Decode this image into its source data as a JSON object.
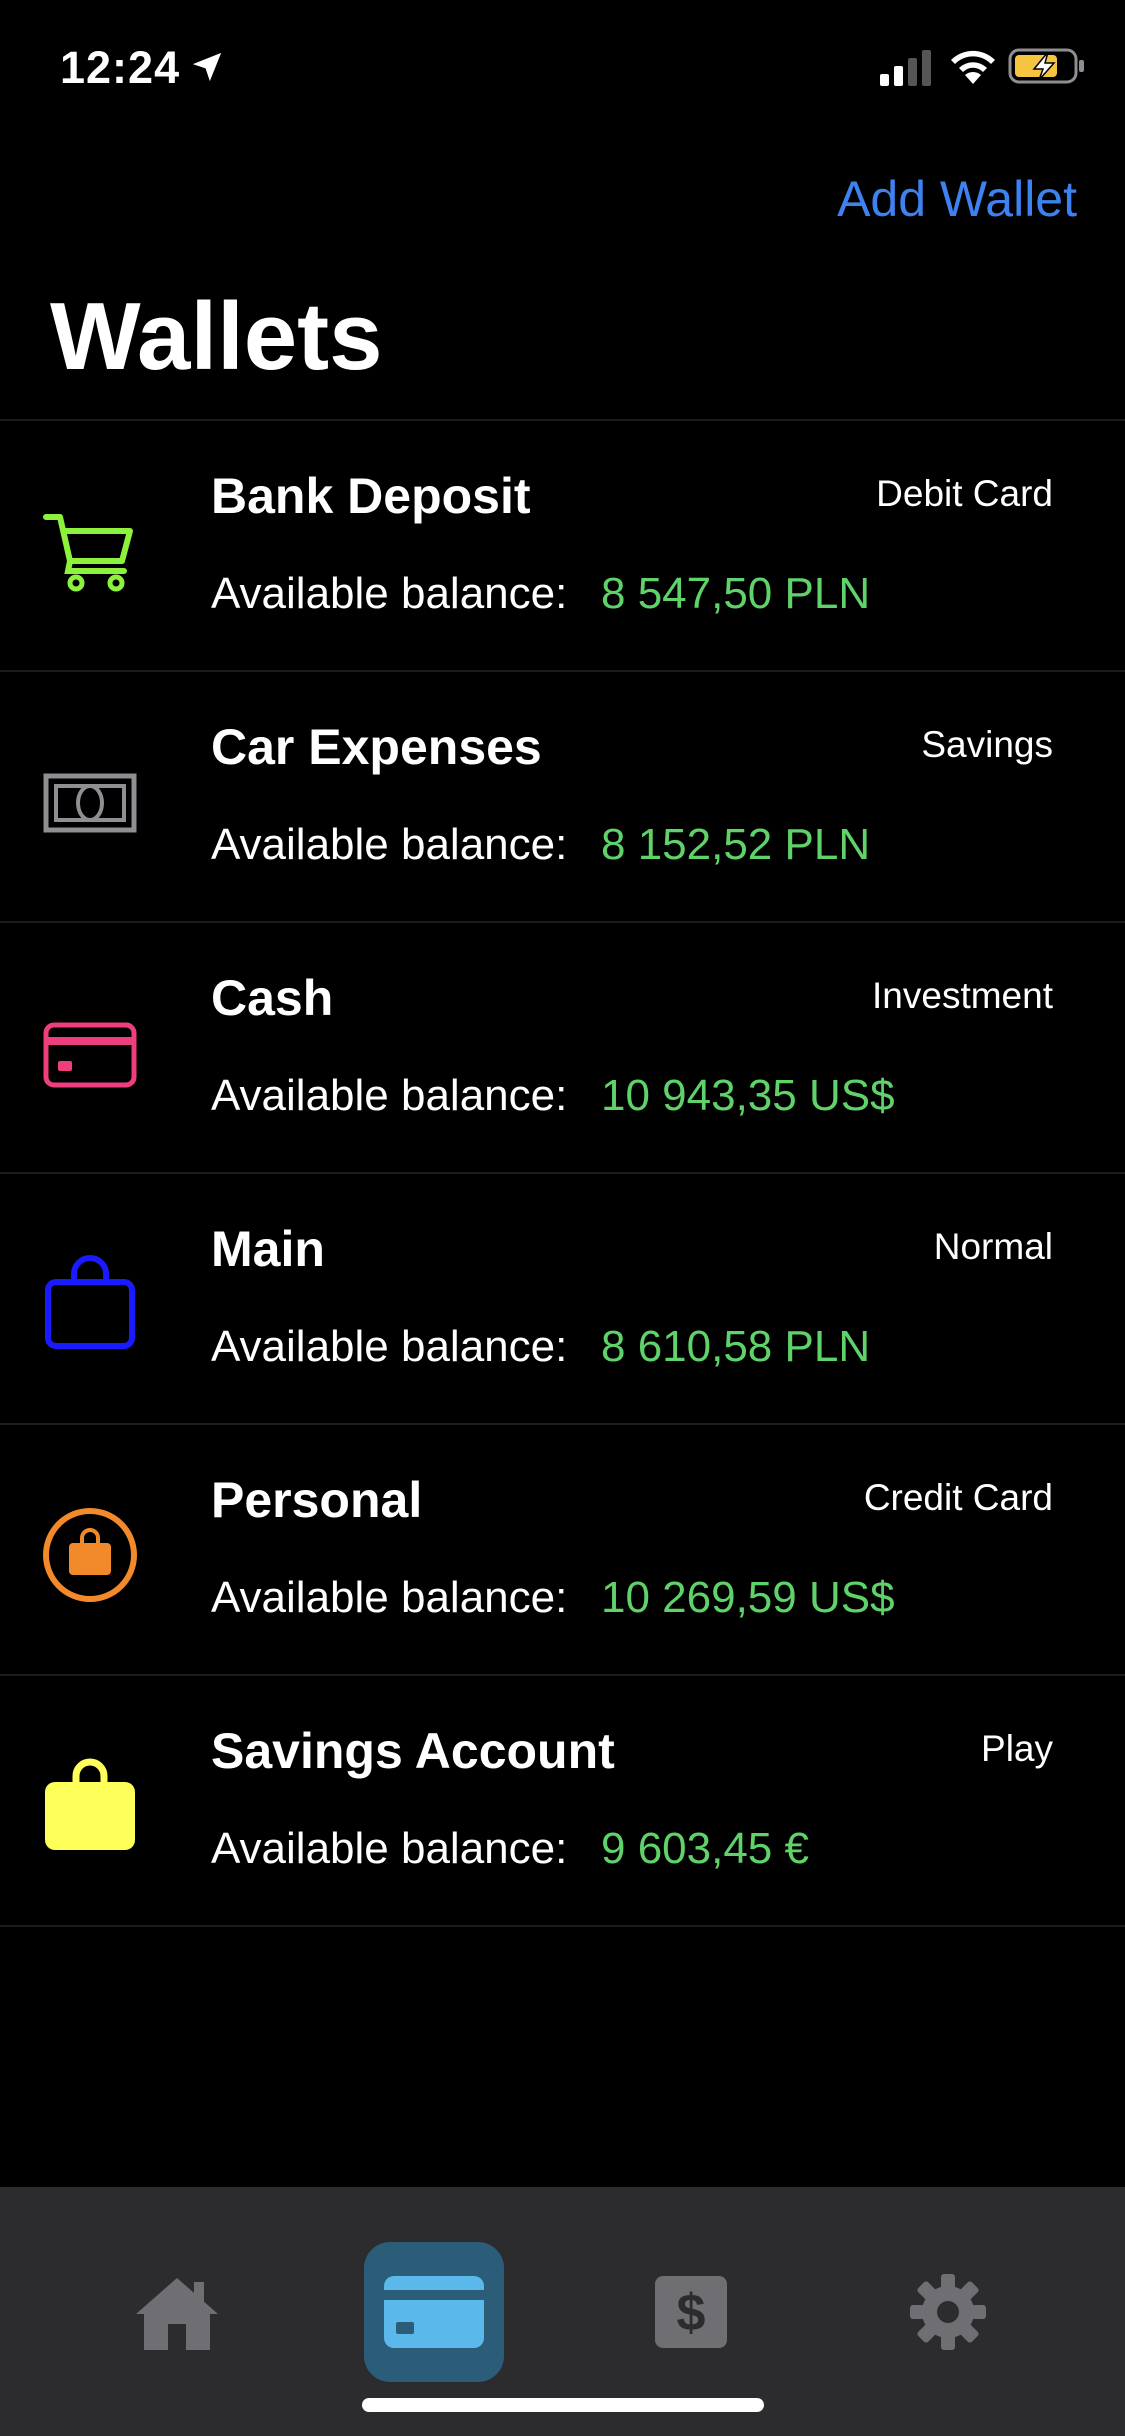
{
  "status_bar": {
    "time": "12:24",
    "icons": [
      "location-arrow-icon",
      "cellular-signal-icon",
      "wifi-icon",
      "battery-charging-icon"
    ]
  },
  "header": {
    "add_wallet_label": "Add Wallet",
    "title": "Wallets",
    "accent_color": "#3d82f0"
  },
  "wallets": [
    {
      "name": "Bank Deposit",
      "type": "Debit Card",
      "balance_label": "Available balance:",
      "balance": "8 547,50 PLN",
      "icon": "cart-icon",
      "icon_color": "#8cf23b"
    },
    {
      "name": "Car Expenses",
      "type": "Savings",
      "balance_label": "Available balance:",
      "balance": "8 152,52 PLN",
      "icon": "banknote-icon",
      "icon_color": "#8e8e93"
    },
    {
      "name": "Cash",
      "type": "Investment",
      "balance_label": "Available balance:",
      "balance": "10 943,35 US$",
      "icon": "credit-card-icon",
      "icon_color": "#ee3e7d"
    },
    {
      "name": "Main",
      "type": "Normal",
      "balance_label": "Available balance:",
      "balance": "8 610,58 PLN",
      "icon": "shopping-bag-icon",
      "icon_color": "#1a1aff"
    },
    {
      "name": "Personal",
      "type": "Credit Card",
      "balance_label": "Available balance:",
      "balance": "10 269,59 US$",
      "icon": "bag-circle-icon",
      "icon_color": "#f28a2c"
    },
    {
      "name": "Savings Account",
      "type": "Play",
      "balance_label": "Available balance:",
      "balance": "9 603,45 €",
      "icon": "shopping-bag-fill-icon",
      "icon_color": "#ffff5a"
    }
  ],
  "balance_color": "#5fd36a",
  "tab_bar": {
    "tabs": [
      {
        "name": "home",
        "icon": "house-icon",
        "selected": false
      },
      {
        "name": "wallets",
        "icon": "credit-card-icon",
        "selected": true
      },
      {
        "name": "money",
        "icon": "dollar-sign-icon",
        "selected": false
      },
      {
        "name": "settings",
        "icon": "gear-icon",
        "selected": false
      }
    ]
  }
}
